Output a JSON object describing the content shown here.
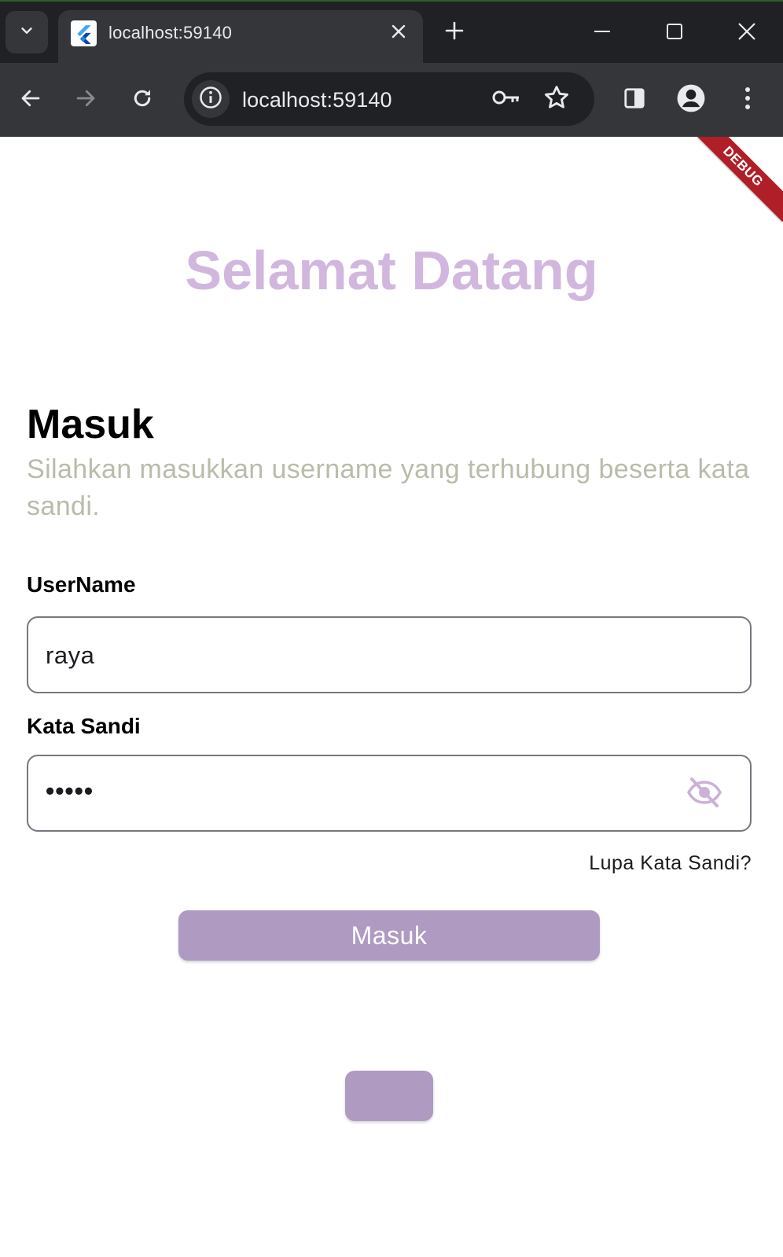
{
  "browser": {
    "tab": {
      "title": "localhost:59140"
    },
    "omnibox": {
      "url": "localhost:59140"
    },
    "icons": {
      "tab_search": "chevron-down-icon",
      "favicon": "flutter-icon",
      "tab_close": "close-icon",
      "new_tab": "plus-icon",
      "minimize": "minimize-icon",
      "maximize": "maximize-icon",
      "close_window": "close-icon",
      "back": "back-arrow-icon",
      "forward": "forward-arrow-icon",
      "reload": "reload-icon",
      "site_info": "info-icon",
      "passwords": "key-icon",
      "bookmark": "star-icon",
      "side_panel": "side-panel-icon",
      "profile": "profile-icon",
      "menu": "kebab-menu-icon"
    }
  },
  "app": {
    "debug_banner": "DEBUG",
    "welcome_title": "Selamat Datang",
    "login_heading": "Masuk",
    "login_subtitle": "Silahkan masukkan username yang terhubung beserta kata sandi.",
    "username": {
      "label": "UserName",
      "value": "raya"
    },
    "password": {
      "label": "Kata Sandi",
      "value_masked": "•••••",
      "visibility_icon": "eye-off-icon"
    },
    "forgot_password_label": "Lupa Kata Sandi?",
    "login_button_label": "Masuk",
    "secondary_button_label": ""
  },
  "colors": {
    "accent": "#d1b7de",
    "button": "#af9ac2",
    "subtitle": "#b9bcaa",
    "debug": "#b01e27",
    "chrome_dark": "#202124",
    "chrome_mid": "#35363a"
  }
}
